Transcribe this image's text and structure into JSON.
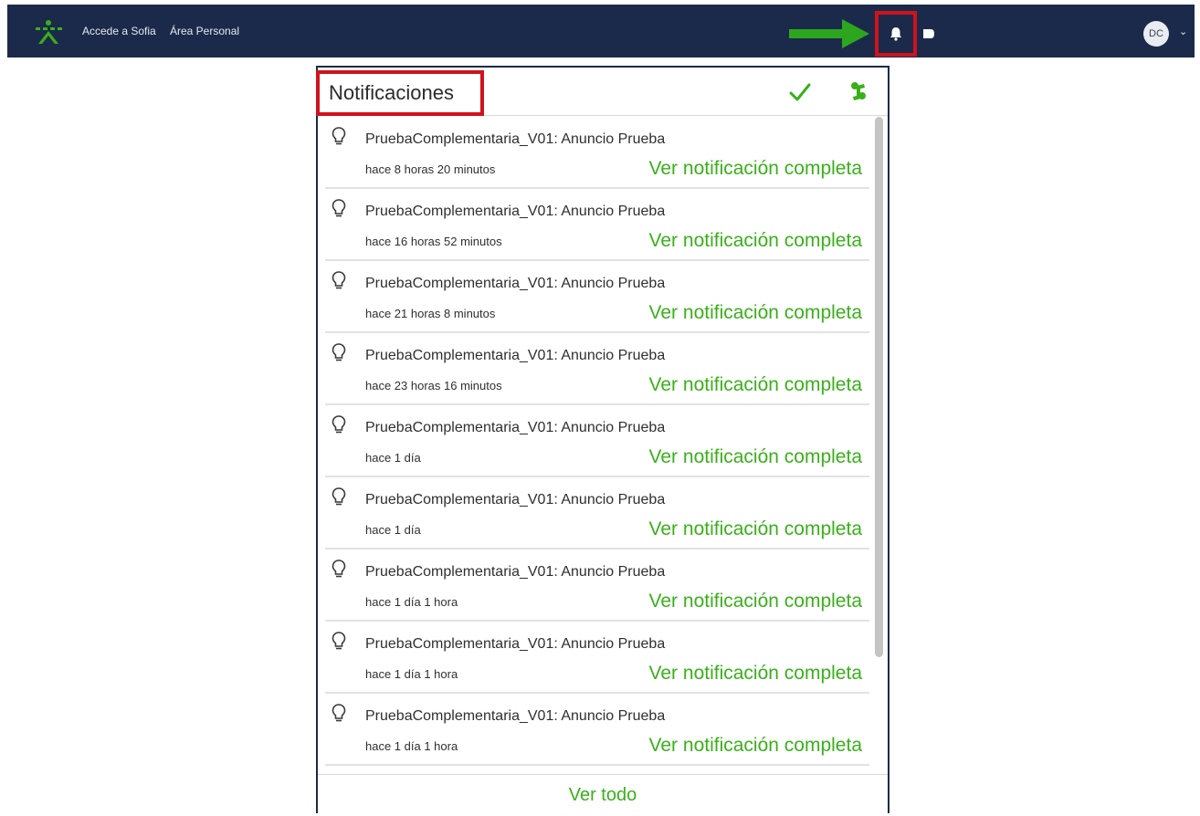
{
  "navbar": {
    "links": [
      "Accede a Sofia",
      "Área Personal"
    ],
    "avatar_initials": "DC",
    "logo_icon": "sena-logo-icon",
    "bell_icon": "bell-icon",
    "message_icon": "message-icon",
    "annotation_arrow_color": "#2ca61e",
    "highlight_color": "#d0121b",
    "bar_color": "#1b2a4a"
  },
  "panel": {
    "title": "Notificaciones",
    "mark_all_read_icon": "check-icon",
    "settings_icon": "settings-icon",
    "see_all": "Ver todo",
    "accent_color": "#39b01a",
    "notifications": [
      {
        "message": "PruebaComplementaria_V01: Anuncio Prueba",
        "time": "hace 8 horas 20 minutos",
        "link": "Ver notificación completa"
      },
      {
        "message": "PruebaComplementaria_V01: Anuncio Prueba",
        "time": "hace 16 horas 52 minutos",
        "link": "Ver notificación completa"
      },
      {
        "message": "PruebaComplementaria_V01: Anuncio Prueba",
        "time": "hace 21 horas 8 minutos",
        "link": "Ver notificación completa"
      },
      {
        "message": "PruebaComplementaria_V01: Anuncio Prueba",
        "time": "hace 23 horas 16 minutos",
        "link": "Ver notificación completa"
      },
      {
        "message": "PruebaComplementaria_V01: Anuncio Prueba",
        "time": "hace 1 día",
        "link": "Ver notificación completa"
      },
      {
        "message": "PruebaComplementaria_V01: Anuncio Prueba",
        "time": "hace 1 día",
        "link": "Ver notificación completa"
      },
      {
        "message": "PruebaComplementaria_V01: Anuncio Prueba",
        "time": "hace 1 día 1 hora",
        "link": "Ver notificación completa"
      },
      {
        "message": "PruebaComplementaria_V01: Anuncio Prueba",
        "time": "hace 1 día 1 hora",
        "link": "Ver notificación completa"
      },
      {
        "message": "PruebaComplementaria_V01: Anuncio Prueba",
        "time": "hace 1 día 1 hora",
        "link": "Ver notificación completa"
      }
    ]
  }
}
